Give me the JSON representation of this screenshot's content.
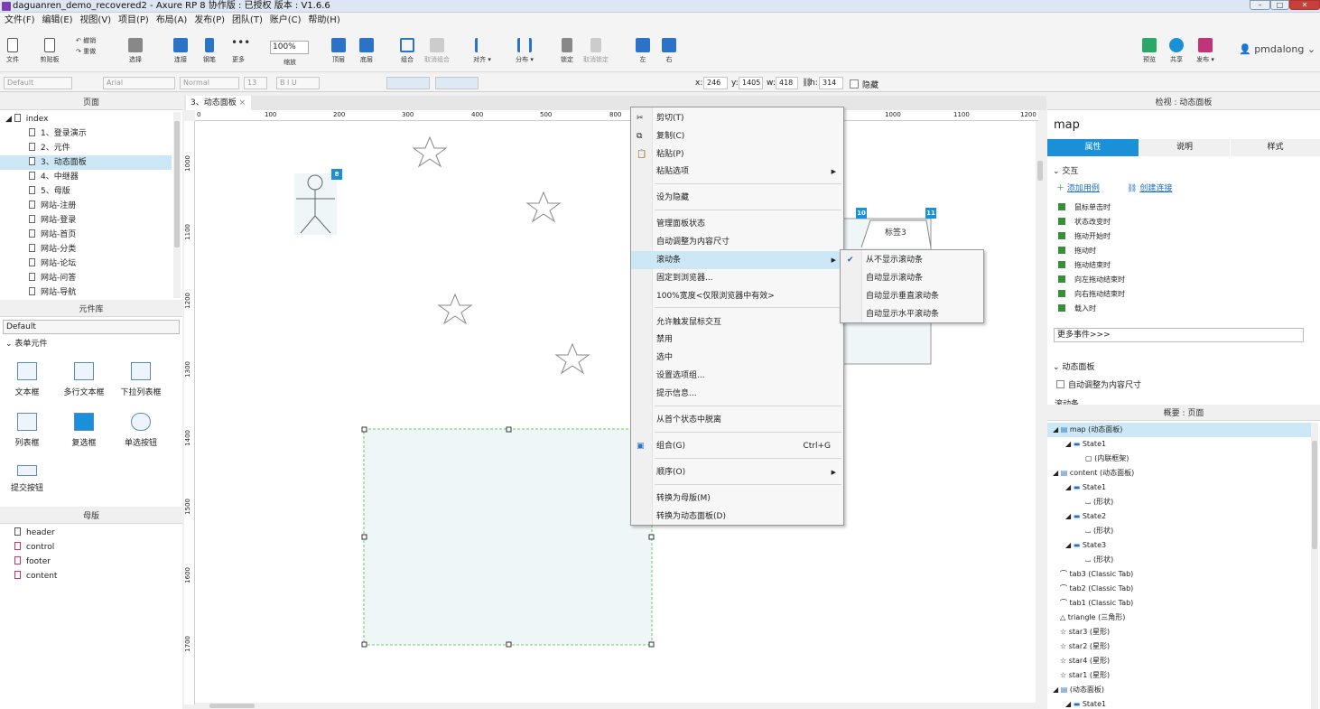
{
  "window": {
    "title": "daguanren_demo_recovered2 - Axure RP 8 协作版 : 已授权 版本 : V1.6.6"
  },
  "menubar": [
    "文件(F)",
    "编辑(E)",
    "视图(V)",
    "项目(P)",
    "布局(A)",
    "发布(P)",
    "团队(T)",
    "账户(C)",
    "帮助(H)"
  ],
  "toolbar": {
    "file": "文件",
    "clipboard": "剪贴板",
    "undo": "撤销",
    "redo": "重做",
    "select": "选择",
    "connect": "连接",
    "pen": "钢笔",
    "more": "更多",
    "zoom_value": "100%",
    "zoom_label": "缩放",
    "top": "顶层",
    "bottom": "底层",
    "group": "组合",
    "ungroup": "取消组合",
    "align": "对齐",
    "distribute": "分布",
    "lock": "锁定",
    "unlock": "取消锁定",
    "left": "左",
    "right": "右",
    "preview": "预览",
    "share": "共享",
    "publish": "发布",
    "user": "pmdalong"
  },
  "format": {
    "style": "Default",
    "font": "Arial",
    "weight": "Normal",
    "size": "13",
    "x_label": "x:",
    "x": "246",
    "y_label": "y:",
    "y": "1405",
    "w_label": "w:",
    "w": "418",
    "h_label": "h:",
    "h": "314",
    "hidden_label": "隐藏"
  },
  "pages_panel": {
    "title": "页面",
    "items": [
      "index",
      "1、登录演示",
      "2、元件",
      "3、动态面板",
      "4、中继器",
      "5、母版",
      "网站-注册",
      "网站-登录",
      "网站-首页",
      "网站-分类",
      "网站-论坛",
      "网站-问答",
      "网站-导航"
    ],
    "selected": "3、动态面板"
  },
  "library_panel": {
    "title": "元件库",
    "dropdown": "Default",
    "section": "表单元件",
    "items": [
      "文本框",
      "多行文本框",
      "下拉列表框",
      "列表框",
      "复选框",
      "单选按钮",
      "提交按钮"
    ]
  },
  "masters_panel": {
    "title": "母版",
    "items": [
      "header",
      "control",
      "footer",
      "content"
    ]
  },
  "editor": {
    "tab": "3、动态面板",
    "ruler_h": [
      "0",
      "100",
      "200",
      "300",
      "400",
      "500",
      "800",
      "1000",
      "1100",
      "1200"
    ],
    "ruler_v": [
      "1000",
      "1100",
      "1200",
      "1300",
      "1400",
      "1500",
      "1600",
      "1700"
    ],
    "badges": [
      "8",
      "10",
      "11"
    ],
    "tab_label": "标签3"
  },
  "context_menu": {
    "items": [
      {
        "label": "剪切(T)",
        "icon": "cut-icon"
      },
      {
        "label": "复制(C)",
        "icon": "copy-icon"
      },
      {
        "label": "粘贴(P)",
        "icon": "paste-icon"
      },
      {
        "label": "粘贴选项",
        "submenu": true
      },
      {
        "label": "设为隐藏"
      },
      {
        "label": "管理面板状态"
      },
      {
        "label": "自动调整为内容尺寸"
      },
      {
        "label": "滚动条",
        "submenu": true,
        "highlighted": true
      },
      {
        "label": "固定到浏览器..."
      },
      {
        "label": "100%宽度<仅限浏览器中有效>"
      },
      {
        "label": "允许触发鼠标交互"
      },
      {
        "label": "禁用"
      },
      {
        "label": "选中"
      },
      {
        "label": "设置选项组..."
      },
      {
        "label": "提示信息..."
      },
      {
        "label": "从首个状态中脱离"
      },
      {
        "label": "组合(G)",
        "shortcut": "Ctrl+G",
        "icon": "group-icon"
      },
      {
        "label": "顺序(O)",
        "submenu": true
      },
      {
        "label": "转换为母版(M)"
      },
      {
        "label": "转换为动态面板(D)"
      }
    ],
    "submenu": {
      "items": [
        "从不显示滚动条",
        "自动显示滚动条",
        "自动显示垂直滚动条",
        "自动显示水平滚动条"
      ],
      "checked": "从不显示滚动条"
    }
  },
  "inspector": {
    "header": "检视 : 动态面板",
    "name": "map",
    "tabs": [
      "属性",
      "说明",
      "样式"
    ],
    "active_tab": "属性",
    "section_interaction": "交互",
    "add_case": "添加用例",
    "create_link": "创建连接",
    "events": [
      "鼠标单击时",
      "状态改变时",
      "拖动开始时",
      "拖动时",
      "拖动结束时",
      "向左拖动结束时",
      "向右拖动结束时",
      "载入时"
    ],
    "more_events": "更多事件>>>",
    "section_panel": "动态面板",
    "fit_content": "自动调整为内容尺寸",
    "scroll_label": "滚动条"
  },
  "outline": {
    "header": "概要 : 页面",
    "items": [
      {
        "label": "map (动态面板)",
        "level": 0
      },
      {
        "label": "State1",
        "level": 1
      },
      {
        "label": "(内联框架)",
        "level": 2
      },
      {
        "label": "content (动态面板)",
        "level": 0
      },
      {
        "label": "State1",
        "level": 1
      },
      {
        "label": "(形状)",
        "level": 2
      },
      {
        "label": "State2",
        "level": 1
      },
      {
        "label": "(形状)",
        "level": 2
      },
      {
        "label": "State3",
        "level": 1
      },
      {
        "label": "(形状)",
        "level": 2
      },
      {
        "label": "tab3 (Classic Tab)",
        "level": 0
      },
      {
        "label": "tab2 (Classic Tab)",
        "level": 0
      },
      {
        "label": "tab1 (Classic Tab)",
        "level": 0
      },
      {
        "label": "triangle (三角形)",
        "level": 0
      },
      {
        "label": "star3 (星形)",
        "level": 0
      },
      {
        "label": "star2 (星形)",
        "level": 0
      },
      {
        "label": "star4 (星形)",
        "level": 0
      },
      {
        "label": "star1 (星形)",
        "level": 0
      },
      {
        "label": "(动态面板)",
        "level": 0
      },
      {
        "label": "State1",
        "level": 1
      }
    ]
  },
  "colors": {
    "accent": "#1a90d9",
    "selection": "#cce8f6",
    "panel_fill": "#eef6f8"
  }
}
